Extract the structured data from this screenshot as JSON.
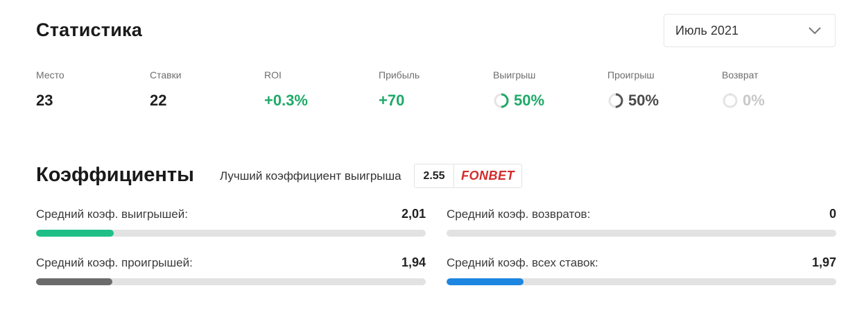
{
  "header": {
    "title": "Статистика",
    "month_select": "Июль 2021"
  },
  "stats": [
    {
      "label": "Место",
      "value": "23"
    },
    {
      "label": "Ставки",
      "value": "22"
    },
    {
      "label": "ROI",
      "value": "+0.3%"
    },
    {
      "label": "Прибыль",
      "value": "+70"
    },
    {
      "label": "Выигрыш",
      "value": "50%",
      "fraction": 0.5
    },
    {
      "label": "Проигрыш",
      "value": "50%",
      "fraction": 0.5
    },
    {
      "label": "Возврат",
      "value": "0%",
      "fraction": 0.0
    }
  ],
  "coefficients": {
    "title": "Коэффициенты",
    "best_label": "Лучший коэффициент выигрыша",
    "best_odd": "2.55",
    "best_bookmaker": "FONBET",
    "rows": [
      {
        "label": "Средний коэф. выигрышей:",
        "value": "2,01",
        "fraction": 0.2,
        "color": "#1fbf87"
      },
      {
        "label": "Средний коэф. возвратов:",
        "value": "0",
        "fraction": 0.0,
        "color": "#8a8a8a"
      },
      {
        "label": "Средний коэф. проигрышей:",
        "value": "1,94",
        "fraction": 0.195,
        "color": "#6b6b6b"
      },
      {
        "label": "Средний коэф. всех ставок:",
        "value": "1,97",
        "fraction": 0.197,
        "color": "#1d86e0"
      }
    ]
  },
  "colors": {
    "win": "#1fa968",
    "loss": "#555555",
    "refund": "#d0d0d0"
  }
}
